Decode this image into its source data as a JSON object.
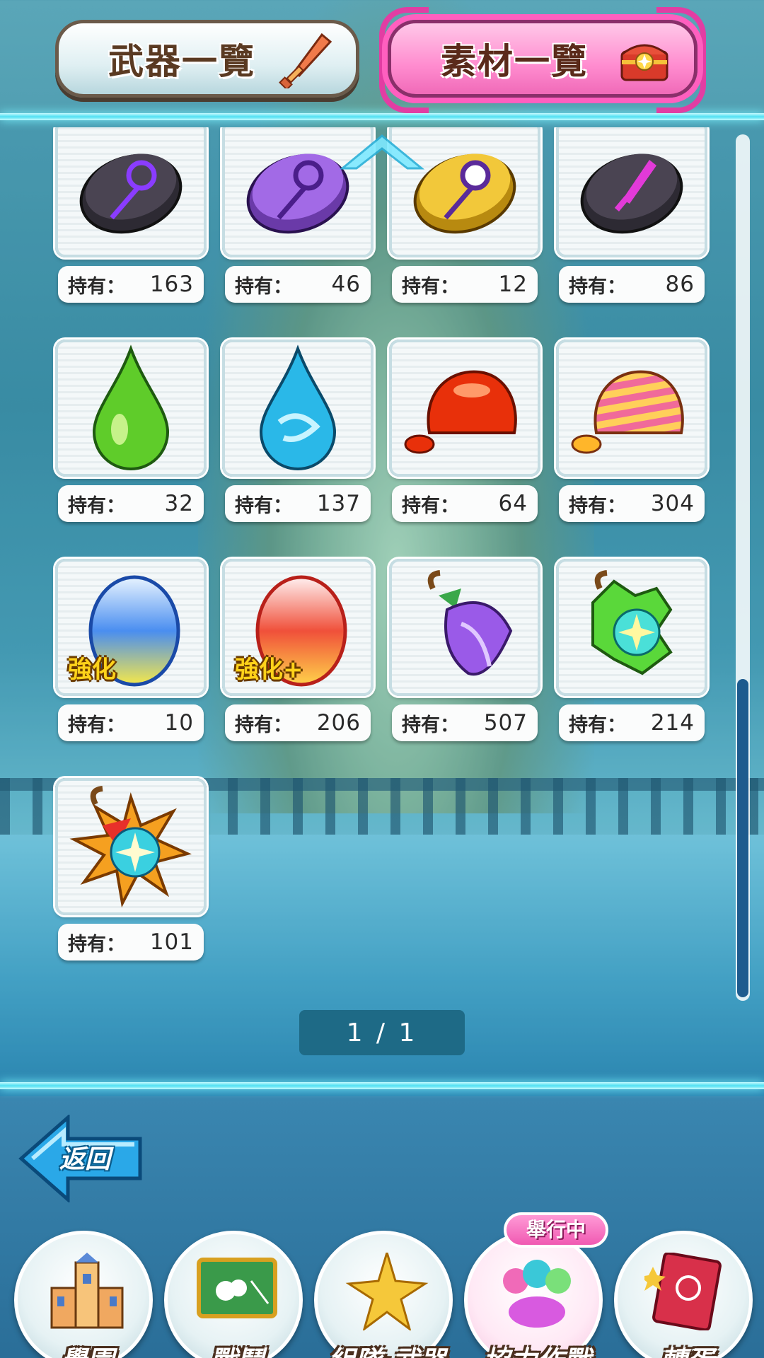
{
  "tabs": {
    "weapons": "武器一覽",
    "materials": "素材一覽"
  },
  "materials": [
    {
      "icon": "dark-purple-rune-stone",
      "label": "持有：",
      "count": "163"
    },
    {
      "icon": "purple-rune-stone",
      "label": "持有：",
      "count": "46"
    },
    {
      "icon": "gold-rune-stone",
      "label": "持有：",
      "count": "12"
    },
    {
      "icon": "dark-pink-sword-rune-stone",
      "label": "持有：",
      "count": "86"
    },
    {
      "icon": "green-drop",
      "label": "持有：",
      "count": "32"
    },
    {
      "icon": "blue-drop",
      "label": "持有：",
      "count": "137"
    },
    {
      "icon": "red-slime",
      "label": "持有：",
      "count": "64"
    },
    {
      "icon": "striped-slime",
      "label": "持有：",
      "count": "304"
    },
    {
      "icon": "blue-enhance-egg",
      "label": "持有：",
      "count": "10",
      "badge": "強化"
    },
    {
      "icon": "red-enhance-plus-egg",
      "label": "持有：",
      "count": "206",
      "badge": "強化+"
    },
    {
      "icon": "purple-fruit",
      "label": "持有：",
      "count": "507"
    },
    {
      "icon": "green-fruit",
      "label": "持有：",
      "count": "214"
    },
    {
      "icon": "rainbow-fruit",
      "label": "持有：",
      "count": "101"
    }
  ],
  "pager": "1 / 1",
  "back": "返回",
  "nav": {
    "academy": "學園",
    "battle": "戰鬥",
    "team": "組隊·武器",
    "coop": "協力作戰",
    "gacha": "轉蛋",
    "event_badge": "舉行中"
  }
}
